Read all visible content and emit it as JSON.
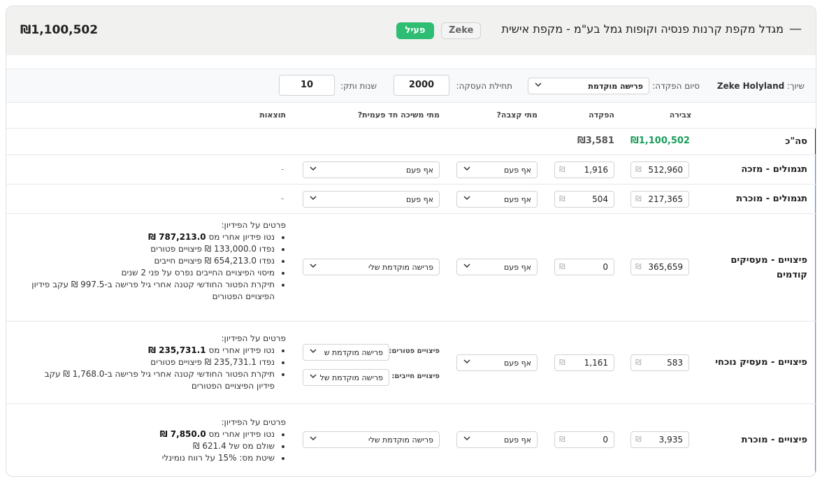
{
  "header": {
    "collapse_icon": "minus-icon",
    "title": "מגדל מקפת קרנות פנסיה וקופות גמל בע\"מ - מקפת אישית",
    "badge_user": "Zeke",
    "badge_status": "פעיל",
    "total": "₪1,100,502",
    "status_color": "#2dbd73"
  },
  "filters": {
    "owner_label": "שיוך:",
    "owner_value": "Zeke Holyland",
    "deposit_end_label": "סיום הפקדה:",
    "deposit_end_value": "פרישה מוקדמת",
    "employment_start_label": "תחילת העסקה:",
    "employment_start_value": "2000",
    "tenure_label": "שנות ותק:",
    "tenure_value": "10"
  },
  "columns": {
    "accumulation": "צבירה",
    "deposit": "הפקדה",
    "allowance_when": "מתי קצבה?",
    "one_time_when": "מתי משיכה חד פעמית?",
    "results": "תוצאות"
  },
  "currency": "₪",
  "total_row": {
    "label": "סה\"כ",
    "accumulation": "₪1,100,502",
    "deposit": "₪3,581",
    "accumulation_color": "#1a9c5b"
  },
  "rows": [
    {
      "label": "תגמולים - מזכה",
      "accumulation": "512,960",
      "deposit": "1,916",
      "allowance": "אף פעם",
      "one_time": "אף פעם",
      "result": "-"
    },
    {
      "label": "תגמולים - מוכרת",
      "accumulation": "217,365",
      "deposit": "504",
      "allowance": "אף פעם",
      "one_time": "אף פעם",
      "result": "-"
    },
    {
      "label": "פיצויים - מעסיקים קודמים",
      "accumulation": "365,659",
      "deposit": "0",
      "allowance": "אף פעם",
      "one_time": "פרישה מוקדמת שלי",
      "results_title": "פרטים על הפידיון:",
      "results_items": [
        {
          "text": "נטו פידיון אחרי מס ",
          "bold": "787,213.0 ₪"
        },
        {
          "text": "נפדו 133,000.0 ₪ פיצויים פטורים",
          "bold": ""
        },
        {
          "text": "נפדו 654,213.0 ₪ פיצויים חייבים",
          "bold": ""
        },
        {
          "text": "מיסוי הפיצויים החייבים נפרס על פני 2 שנים",
          "bold": ""
        },
        {
          "text": "תיקרת הפטור החודשי קטנה אחרי גיל פרישה ב-997.5 ₪ עקב פידיון הפיצויים הפטורים",
          "bold": ""
        }
      ]
    },
    {
      "label": "פיצויים - מעסיק נוכחי",
      "accumulation": "583",
      "deposit": "1,161",
      "allowance": "אף פעם",
      "exempt_label": "פיצויים פטורים:",
      "exempt_value": "פרישה מוקדמת ש",
      "taxable_label": "פיצויים חייבים:",
      "taxable_value": "פרישה מוקדמת של",
      "results_title": "פרטים על הפידיון:",
      "results_items": [
        {
          "text": "נטו פידיון אחרי מס ",
          "bold": "235,731.1 ₪"
        },
        {
          "text": "נפדו 235,731.1 ₪ פיצויים פטורים",
          "bold": ""
        },
        {
          "text": "תיקרת הפטור החודשי קטנה אחרי גיל פרישה ב-1,768.0 ₪ עקב פידיון הפיצויים הפטורים",
          "bold": ""
        }
      ]
    },
    {
      "label": "פיצויים - מוכרת",
      "accumulation": "3,935",
      "deposit": "0",
      "allowance": "אף פעם",
      "one_time": "פרישה מוקדמת שלי",
      "results_title": "פרטים על הפידיון:",
      "results_items": [
        {
          "text": "נטו פידיון אחרי מס ",
          "bold": "7,850.0 ₪"
        },
        {
          "text": "שולם מס של 621.4 ₪",
          "bold": ""
        },
        {
          "text": "שיטת מס: 15% על רווח נומינלי",
          "bold": ""
        }
      ]
    }
  ],
  "edge_colors": {
    "total": "#222222",
    "tagmulim_zakai": "#4a8fe0",
    "tagmulim_mukeret": "#4a8fe0",
    "pitzuyim": "#9b6de0",
    "pitzuyim_mukeret": "#c7e3f2"
  }
}
